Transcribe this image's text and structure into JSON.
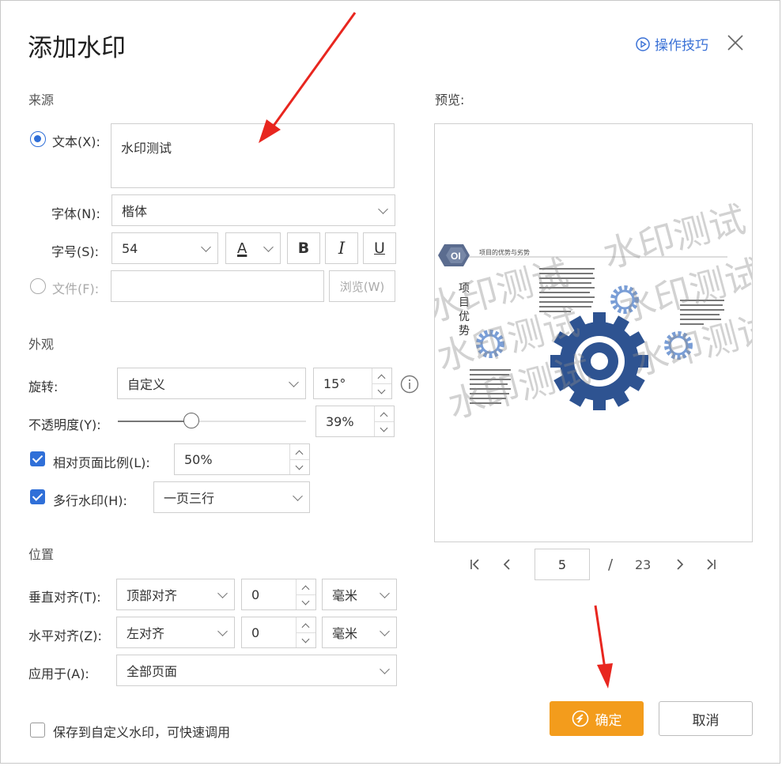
{
  "dialog": {
    "title": "添加水印",
    "tips_label": "操作技巧"
  },
  "source": {
    "section": "来源",
    "text_option": "文本(X):",
    "text_value": "水印测试",
    "font_label": "字体(N):",
    "font_value": "楷体",
    "size_label": "字号(S):",
    "size_value": "54",
    "color_glyph": "A",
    "bold_glyph": "B",
    "italic_glyph": "I",
    "underline_glyph": "U",
    "file_option": "文件(F):",
    "browse_label": "浏览(W)"
  },
  "appearance": {
    "section": "外观",
    "rotation_label": "旋转:",
    "rotation_mode": "自定义",
    "rotation_value": "15°",
    "opacity_label": "不透明度(Y):",
    "opacity_value": "39%",
    "opacity_fraction": 0.39,
    "relative_scale_label": "相对页面比例(L):",
    "relative_scale_value": "50%",
    "multi_label": "多行水印(H):",
    "multi_value": "一页三行"
  },
  "position": {
    "section": "位置",
    "vertical_label": "垂直对齐(T):",
    "vertical_value": "顶部对齐",
    "vertical_offset": "0",
    "vertical_unit": "毫米",
    "horizontal_label": "水平对齐(Z):",
    "horizontal_value": "左对齐",
    "horizontal_offset": "0",
    "horizontal_unit": "毫米",
    "apply_label": "应用于(A):",
    "apply_value": "全部页面"
  },
  "preview": {
    "label": "预览:",
    "slide_badge": "OI",
    "slide_header": "项目的优势与劣势",
    "slide_vertical_title": "项目优势",
    "watermark_text": "水印测试",
    "current_page": "5",
    "separator": "/",
    "total_pages": "23"
  },
  "footer": {
    "save_custom": "保存到自定义水印，可快速调用",
    "ok_label": "确定",
    "cancel_label": "取消"
  },
  "colors": {
    "accent": "#2f6fd8",
    "ok": "#f39c1c",
    "gear": "#2e5391"
  }
}
